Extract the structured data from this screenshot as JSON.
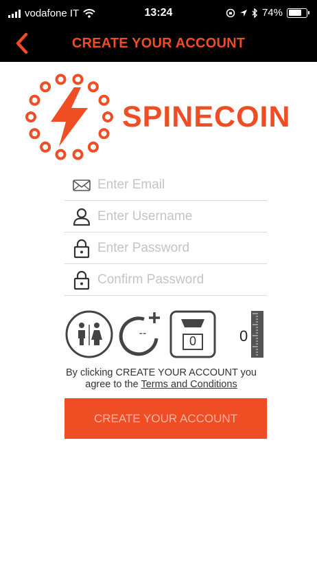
{
  "status_bar": {
    "carrier": "vodafone IT",
    "time": "13:24",
    "battery": "74%",
    "battery_level": 0.74
  },
  "nav": {
    "title": "CREATE YOUR ACCOUNT",
    "back_icon": "chevron-left-icon"
  },
  "brand": {
    "name": "SPINECOIN",
    "logo_icon": "lightning-chain-icon"
  },
  "form": {
    "email": {
      "placeholder": "Enter Email",
      "value": "",
      "icon": "envelope-icon"
    },
    "username": {
      "placeholder": "Enter Username",
      "value": "",
      "icon": "user-icon"
    },
    "password": {
      "placeholder": "Enter Password",
      "value": "",
      "icon": "lock-icon"
    },
    "confirm": {
      "placeholder": "Confirm Password",
      "value": "",
      "icon": "lock-icon"
    }
  },
  "profile": {
    "gender_icon": "gender-icon",
    "age_value": "--",
    "weight_value": "0",
    "height_value": "0"
  },
  "terms": {
    "line1": "By clicking CREATE YOUR ACCOUNT you",
    "line2_prefix": "agree to the ",
    "link": "Terms and Conditions"
  },
  "cta": {
    "label": "CREATE YOUR ACCOUNT"
  },
  "colors": {
    "accent": "#ef4d24",
    "topbar": "#000000",
    "cta_text": "#f7b7a4"
  }
}
